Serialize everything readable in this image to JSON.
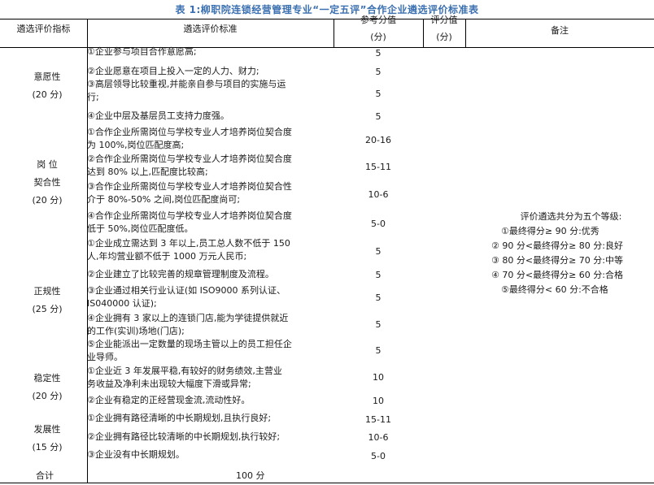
{
  "title": "表 1:柳职院连锁经营管理专业“一定五评”合作企业遴选评价标准表",
  "headers": {
    "indicator": "遴选评价指标",
    "standard": "遴选评价标准",
    "ref_score_l1": "参考分值",
    "ref_score_l2": "(分)",
    "eval_score_l1": "评分值",
    "eval_score_l2": "(分)",
    "remark": "备注"
  },
  "categories": [
    {
      "name": "意愿性",
      "points": "(20 分)"
    },
    {
      "name": "岗 位",
      "name2": "契合性",
      "points": "(20 分)"
    },
    {
      "name": "正规性",
      "points": "(25 分)"
    },
    {
      "name": "稳定性",
      "points": "(20 分)"
    },
    {
      "name": "发展性",
      "points": "(15 分)"
    }
  ],
  "rows": [
    {
      "criterion": "①企业参与项目合作意愿高;",
      "score": "5"
    },
    {
      "criterion": "②企业愿意在项目上投入一定的人力、财力;",
      "score": "5"
    },
    {
      "criterion": "③高层领导比较重视,并能亲自参与项目的实施与运\n行;",
      "score": "5"
    },
    {
      "criterion": "④企业中层及基层员工支持力度强。",
      "score": "5"
    },
    {
      "criterion": "①合作企业所需岗位与学校专业人才培养岗位契合度\n为 100%,岗位匹配度高;",
      "score": "20-16"
    },
    {
      "criterion": "②合作企业所需岗位与学校专业人才培养岗位契合度\n达到 80% 以上,匹配度比较高;",
      "score": "15-11"
    },
    {
      "criterion": "③合作企业所需岗位与学校专业人才培养岗位契合性\n介于 80%-50% 之间,岗位匹配度尚可;",
      "score": "10-6"
    },
    {
      "criterion": "④合作企业所需岗位与学校专业人才培养岗位契合度\n低于 50%,岗位匹配度低。",
      "score": "5-0"
    },
    {
      "criterion": "①企业成立需达到 3 年以上,员工总人数不低于 150\n人,年均营业额不低于 1000 万元人民币;",
      "score": "5"
    },
    {
      "criterion": "②企业建立了比较完善的规章管理制度及流程。",
      "score": "5"
    },
    {
      "criterion": "③企业通过相关行业认证(如 ISO9000 系列认证、\nIS040000 认证);",
      "score": "5"
    },
    {
      "criterion": "④企业拥有 3 家以上的连锁门店,能为学徒提供就近\n的工作(实训)场地(门店);",
      "score": "5"
    },
    {
      "criterion": "⑤企业能派出一定数量的现场主管以上的员工担任企\n业导师。",
      "score": "5"
    },
    {
      "criterion": "①企业近 3 年发展平稳,有较好的财务绩效,主营业\n务收益及净利未出现较大幅度下滑或异常;",
      "score": "10"
    },
    {
      "criterion": "②企业有稳定的正经营现金流,流动性好。",
      "score": "10"
    },
    {
      "criterion": "①企业拥有路径清晰的中长期规划,且执行良好;",
      "score": "15-11"
    },
    {
      "criterion": "②企业拥有路径比较清晰的中长期规划,执行较好;",
      "score": "10-6"
    },
    {
      "criterion": "③企业没有中长期规划。",
      "score": "5-0"
    }
  ],
  "remarks": [
    "评价遴选共分为五个等级:",
    "①最终得分≥ 90 分:优秀",
    "② 90 分<最终得分≥ 80 分:良好",
    "③ 80 分<最终得分≥ 70 分:中等",
    "④ 70 分<最终得分≥ 60 分:合格",
    "⑤最终得分< 60 分:不合格"
  ],
  "total": {
    "label": "合计",
    "value": "100 分"
  }
}
